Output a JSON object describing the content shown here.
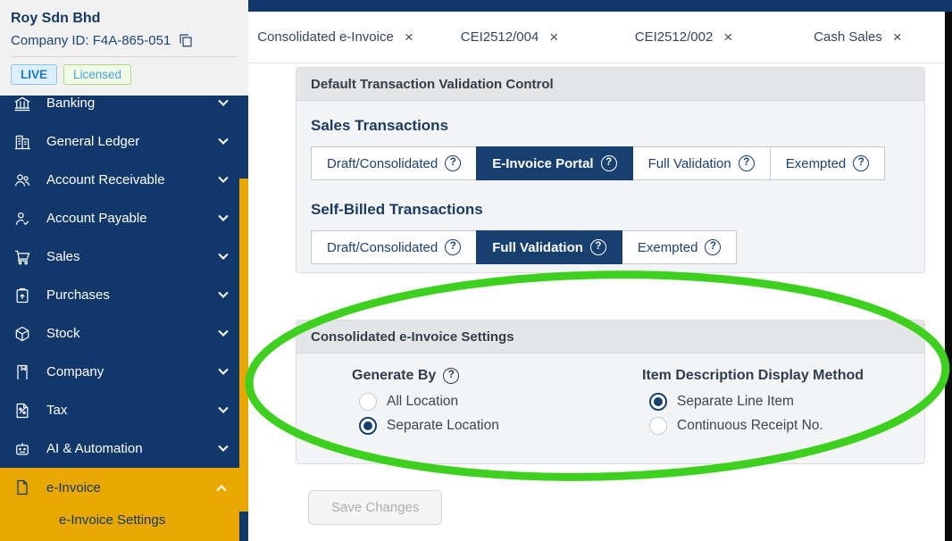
{
  "glyphs": {
    "help": "?",
    "close": "×"
  },
  "colors": {
    "sidebar_navy": "#12386B",
    "selected_navy": "#174070",
    "accent_gold": "#E9A800",
    "annotation_green": "#3ED01E",
    "live_badge_blue": "#1F78C0",
    "licensed_badge_green": "#ABDB7E"
  },
  "sidebar": {
    "company": {
      "name": "Roy Sdn Bhd",
      "id_label": "Company ID: F4A-865-051"
    },
    "badges": {
      "live": "LIVE",
      "licensed": "Licensed"
    },
    "items": [
      {
        "label": "Banking",
        "icon": "banking-icon"
      },
      {
        "label": "General Ledger",
        "icon": "general-ledger-icon"
      },
      {
        "label": "Account Receivable",
        "icon": "account-receivable-icon"
      },
      {
        "label": "Account Payable",
        "icon": "account-payable-icon"
      },
      {
        "label": "Sales",
        "icon": "sales-icon"
      },
      {
        "label": "Purchases",
        "icon": "purchases-icon"
      },
      {
        "label": "Stock",
        "icon": "stock-icon"
      },
      {
        "label": "Company",
        "icon": "company-icon"
      },
      {
        "label": "Tax",
        "icon": "tax-icon"
      },
      {
        "label": "AI & Automation",
        "icon": "ai-automation-icon"
      }
    ],
    "active_group": {
      "label": "e-Invoice",
      "icon": "e-invoice-icon",
      "sub_items": [
        {
          "label": "e-Invoice Settings"
        }
      ]
    }
  },
  "tabs": [
    {
      "label": "Consolidated e-Invoice"
    },
    {
      "label": "CEI2512/004"
    },
    {
      "label": "CEI2512/002"
    },
    {
      "label": "Cash Sales"
    }
  ],
  "main": {
    "validation_card": {
      "title": "Default Transaction Validation Control",
      "sales": {
        "heading": "Sales Transactions",
        "options": [
          {
            "label": "Draft/Consolidated",
            "selected": false
          },
          {
            "label": "E-Invoice Portal",
            "selected": true
          },
          {
            "label": "Full Validation",
            "selected": false
          },
          {
            "label": "Exempted",
            "selected": false
          }
        ]
      },
      "self_billed": {
        "heading": "Self-Billed Transactions",
        "options": [
          {
            "label": "Draft/Consolidated",
            "selected": false
          },
          {
            "label": "Full Validation",
            "selected": true
          },
          {
            "label": "Exempted",
            "selected": false
          }
        ]
      }
    },
    "consolidated_card": {
      "title": "Consolidated e-Invoice Settings",
      "generate_by": {
        "heading": "Generate By",
        "options": [
          {
            "label": "All Location",
            "selected": false
          },
          {
            "label": "Separate Location",
            "selected": true
          }
        ]
      },
      "item_description": {
        "heading": "Item Description Display Method",
        "options": [
          {
            "label": "Separate Line Item",
            "selected": true
          },
          {
            "label": "Continuous Receipt No.",
            "selected": false
          }
        ]
      }
    },
    "save_button_label": "Save Changes"
  },
  "annotation": {
    "shape": "ellipse",
    "color": "#3ED01E",
    "meaning": "highlights Consolidated e-Invoice Settings section"
  }
}
